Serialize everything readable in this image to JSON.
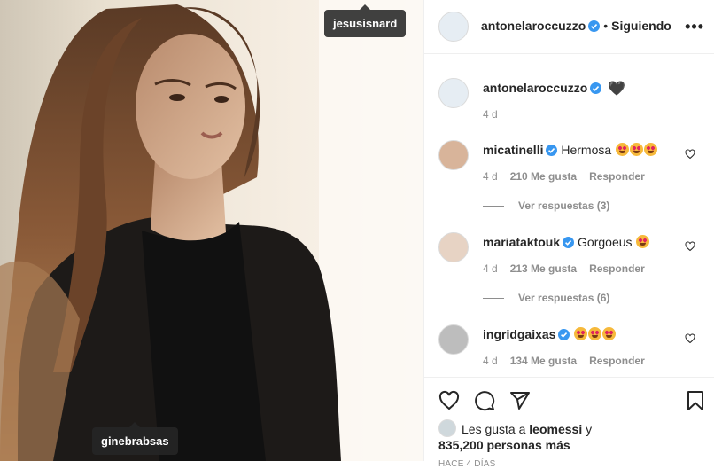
{
  "photo": {
    "tag_top": "jesusisnard",
    "tag_bottom": "ginebrabsas"
  },
  "header": {
    "username": "antonelaroccuzzo",
    "separator": "•",
    "following": "Siguiendo",
    "more": "•••"
  },
  "caption": {
    "username": "antonelaroccuzzo",
    "text": "🖤",
    "time": "4 d"
  },
  "comments": [
    {
      "username": "micatinelli",
      "text": "Hermosa",
      "emoji_count": 3,
      "time": "4 d",
      "likes": "210 Me gusta",
      "reply": "Responder",
      "view_replies": "Ver respuestas (3)"
    },
    {
      "username": "mariataktouk",
      "text": "Gorgoeus",
      "emoji_count": 1,
      "time": "4 d",
      "likes": "213 Me gusta",
      "reply": "Responder",
      "view_replies": "Ver respuestas (6)"
    },
    {
      "username": "ingridgaixas",
      "text": "",
      "emoji_count": 3,
      "time": "4 d",
      "likes": "134 Me gusta",
      "reply": "Responder"
    }
  ],
  "likes": {
    "prefix": "Les gusta a",
    "user": "leomessi",
    "suffix": "y",
    "others": "835,200 personas más"
  },
  "time_ago": "HACE 4 DÍAS",
  "colors": {
    "verified": "#3897f0",
    "muted": "#8e8e8e",
    "text": "#262626",
    "emoji": "#f6b93b"
  },
  "icons": [
    "heart-icon",
    "comment-icon",
    "share-icon",
    "bookmark-icon",
    "verified-icon",
    "more-icon"
  ]
}
